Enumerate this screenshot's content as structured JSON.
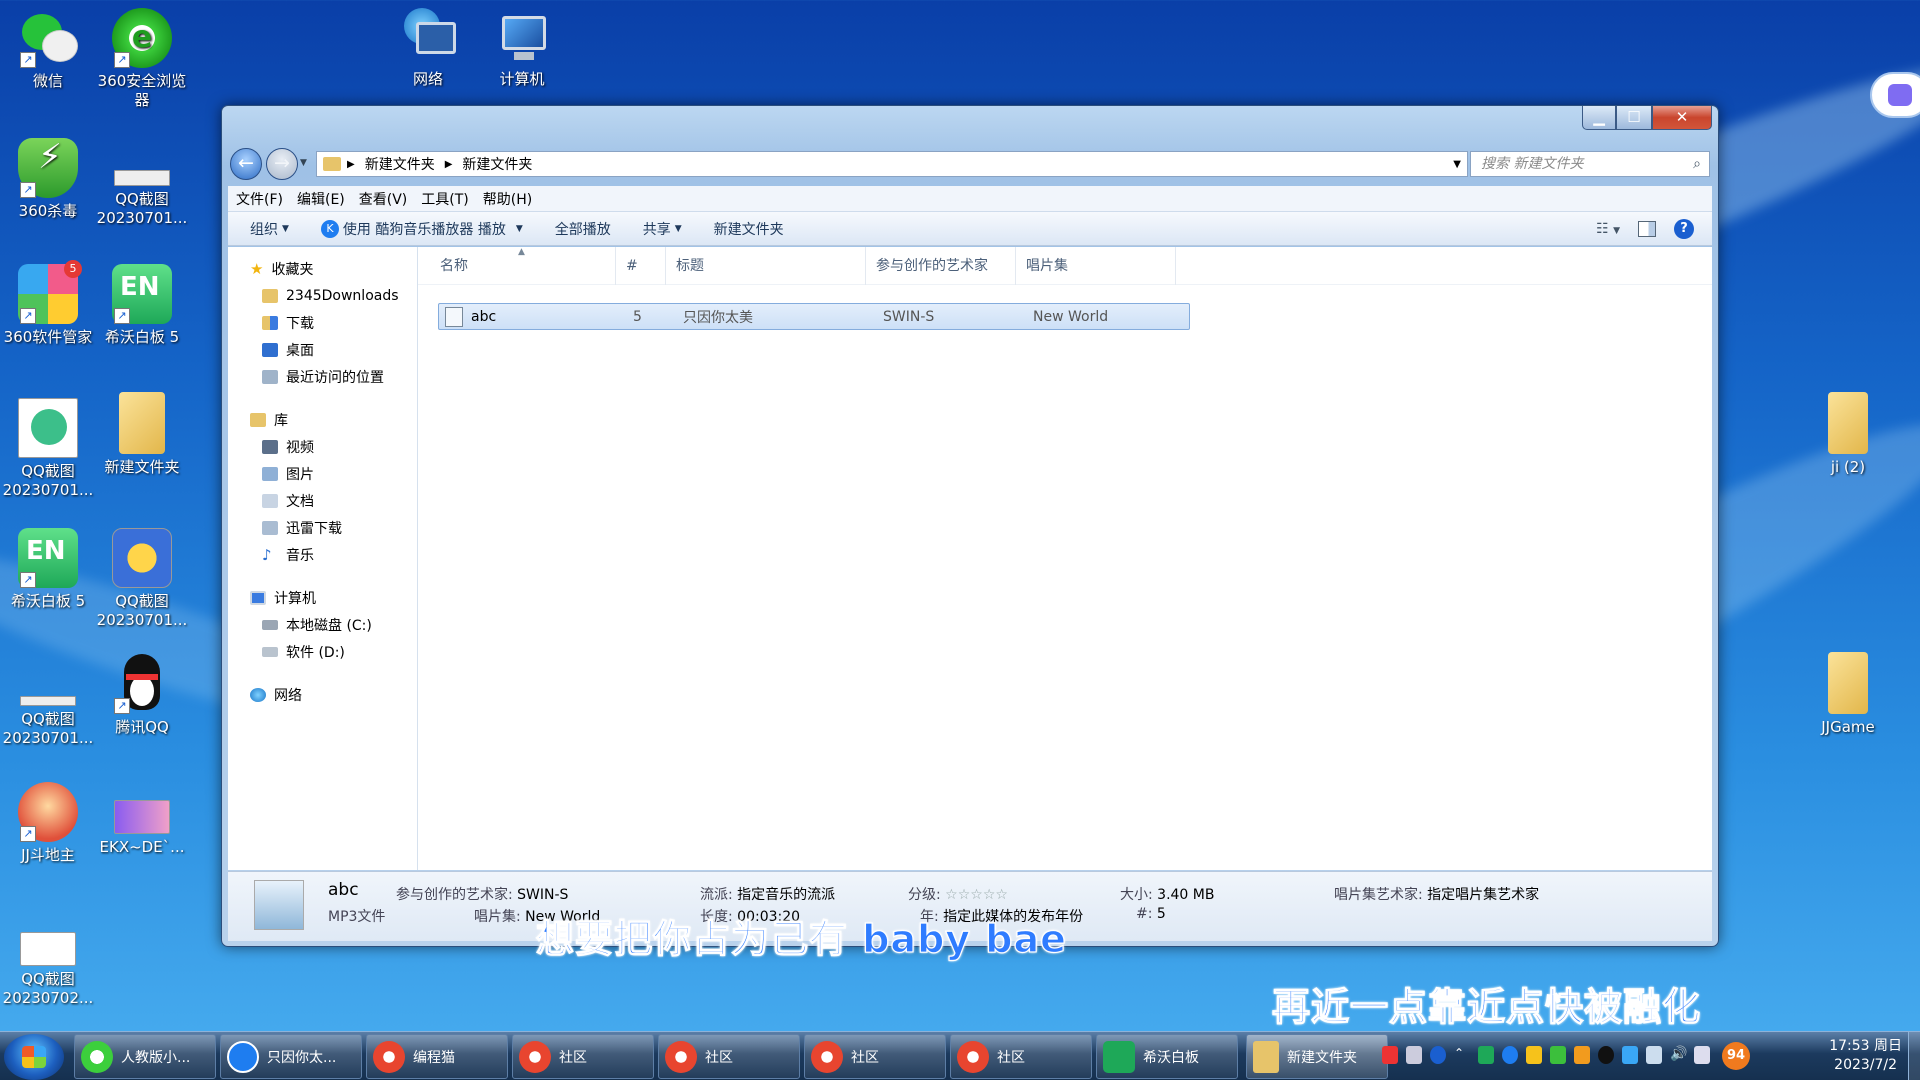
{
  "desktop_icons_left": [
    {
      "label": "微信",
      "icon": "wechat-icon"
    },
    {
      "label": "360安全浏览器",
      "icon": "browser-360-icon"
    },
    {
      "label": "360杀毒",
      "icon": "antivirus-360-icon"
    },
    {
      "label": "QQ截图20230701...",
      "icon": "screenshot-icon"
    },
    {
      "label": "360软件管家",
      "icon": "software-manager-icon",
      "badge": "5"
    },
    {
      "label": "希沃白板 5",
      "icon": "easinote-icon"
    },
    {
      "label": "QQ截图20230701...",
      "icon": "screenshot-icon"
    },
    {
      "label": "新建文件夹",
      "icon": "folder-icon"
    },
    {
      "label": "希沃白板 5",
      "icon": "easinote-icon"
    },
    {
      "label": "QQ截图20230701...",
      "icon": "screenshot-icon"
    },
    {
      "label": "QQ截图20230701...",
      "icon": "screenshot-icon"
    },
    {
      "label": "腾讯QQ",
      "icon": "qq-penguin-icon"
    },
    {
      "label": "JJ斗地主",
      "icon": "jj-landlord-icon"
    },
    {
      "label": "EKX~DE`...",
      "icon": "screenshot-icon"
    },
    {
      "label": "QQ截图20230702...",
      "icon": "screenshot-icon"
    },
    {
      "label": "网络",
      "icon": "network-icon"
    },
    {
      "label": "计算机",
      "icon": "computer-icon"
    }
  ],
  "desktop_icons_right": [
    {
      "label": "ji (2)",
      "icon": "folder-icon"
    },
    {
      "label": "JJGame",
      "icon": "folder-icon"
    }
  ],
  "explorer": {
    "breadcrumb": [
      "新建文件夹",
      "新建文件夹"
    ],
    "search_placeholder": "搜索 新建文件夹",
    "menus": [
      "文件(F)",
      "编辑(E)",
      "查看(V)",
      "工具(T)",
      "帮助(H)"
    ],
    "toolbar": {
      "organize": "组织",
      "play_with": "使用 酷狗音乐播放器 播放",
      "play_all": "全部播放",
      "share": "共享",
      "new_folder": "新建文件夹"
    },
    "nav": {
      "favorites": "收藏夹",
      "favorites_items": [
        "2345Downloads",
        "下载",
        "桌面",
        "最近访问的位置"
      ],
      "libraries": "库",
      "libraries_items": [
        "视频",
        "图片",
        "文档",
        "迅雷下载",
        "音乐"
      ],
      "computer": "计算机",
      "computer_items": [
        "本地磁盘 (C:)",
        "软件 (D:)"
      ],
      "network": "网络"
    },
    "columns": [
      "名称",
      "#",
      "标题",
      "参与创作的艺术家",
      "唱片集"
    ],
    "rows": [
      {
        "name": "abc",
        "track": "5",
        "title": "只因你太美",
        "artist": "SWIN-S",
        "album": "New World"
      }
    ],
    "details": {
      "name": "abc",
      "type": "MP3文件",
      "artist_label": "参与创作的艺术家:",
      "artist": "SWIN-S",
      "album_label": "唱片集:",
      "album": "New World",
      "genre_label": "流派:",
      "genre": "指定音乐的流派",
      "length_label": "长度:",
      "length": "00:03:20",
      "rating_label": "分级:",
      "rating": 0,
      "year_label": "年:",
      "year": "指定此媒体的发布年份",
      "size_label": "大小:",
      "size": "3.40 MB",
      "track_label": "#:",
      "track": "5",
      "album_artist_label": "唱片集艺术家:",
      "album_artist": "指定唱片集艺术家"
    }
  },
  "subtitles": [
    "想要把你占为己有 baby bae",
    "再近一点靠近点快被融化"
  ],
  "taskbar": {
    "items": [
      "人教版小...",
      "只因你太...",
      "编程猫",
      "社区",
      "社区",
      "社区",
      "社区",
      "希沃白板",
      "新建文件夹"
    ],
    "badge": "94",
    "time": "17:53 周日",
    "date": "2023/7/2"
  }
}
